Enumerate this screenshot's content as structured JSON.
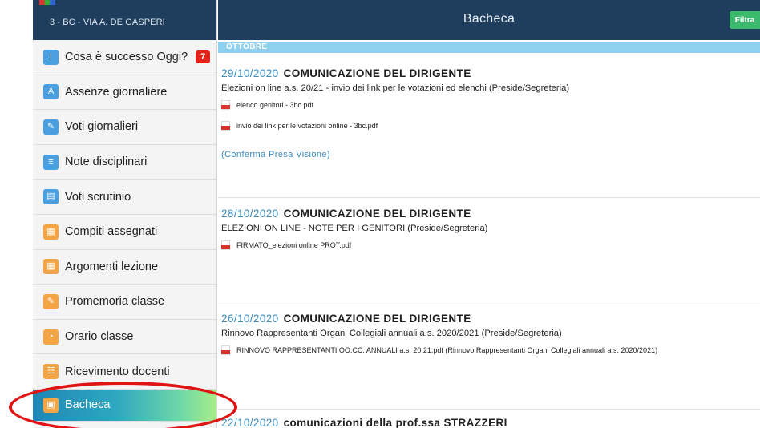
{
  "sidebar": {
    "school_name": "3 - BC - VIA A. DE GASPERI",
    "items": [
      {
        "label": "Cosa è successo Oggi?",
        "icon": "alert-icon",
        "badge": "7"
      },
      {
        "label": "Assenze giornaliere",
        "icon": "attendance-icon"
      },
      {
        "label": "Voti giornalieri",
        "icon": "grades-icon"
      },
      {
        "label": "Note disciplinari",
        "icon": "notes-icon"
      },
      {
        "label": "Voti scrutinio",
        "icon": "report-card-icon"
      },
      {
        "label": "Compiti assegnati",
        "icon": "homework-icon"
      },
      {
        "label": "Argomenti lezione",
        "icon": "lesson-topics-icon"
      },
      {
        "label": "Promemoria classe",
        "icon": "reminder-icon"
      },
      {
        "label": "Orario classe",
        "icon": "clock-icon"
      },
      {
        "label": "Ricevimento docenti",
        "icon": "meeting-icon"
      },
      {
        "label": "Bacheca",
        "icon": "board-icon"
      }
    ]
  },
  "header": {
    "title": "Bacheca",
    "filter_label": "Filtra"
  },
  "month_label": "OTTOBRE",
  "posts": [
    {
      "date": "29/10/2020",
      "title": "COMUNICAZIONE DEL DIRIGENTE",
      "subtitle": "Elezioni on line a.s. 20/21 - invio dei link per le votazioni ed elenchi (Preside/Segreteria)",
      "attachments": [
        "elenco genitori - 3bc.pdf",
        "invio dei link per le votazioni online - 3bc.pdf"
      ],
      "confirm": "(Conferma Presa Visione)"
    },
    {
      "date": "28/10/2020",
      "title": "COMUNICAZIONE DEL DIRIGENTE",
      "subtitle": "ELEZIONI ON LINE - NOTE PER I GENITORI (Preside/Segreteria)",
      "attachments": [
        "FIRMATO_elezioni online PROT.pdf"
      ]
    },
    {
      "date": "26/10/2020",
      "title": "COMUNICAZIONE DEL DIRIGENTE",
      "subtitle": "Rinnovo Rappresentanti Organi Collegiali annuali a.s. 2020/2021 (Preside/Segreteria)",
      "attachments": [
        "RINNOVO RAPPRESENTANTI OO.CC. ANNUALI a.s. 20.21.pdf (Rinnovo Rappresentanti Organi Collegiali annuali a.s. 2020/2021)"
      ]
    },
    {
      "date": "22/10/2020",
      "title": "comunicazioni della prof.ssa STRAZZERI"
    }
  ],
  "colors": {
    "header_bg": "#1f3d5c",
    "date_blue": "#3a8bc2",
    "badge_red": "#e2231a",
    "filter_green": "#3bb96d",
    "highlight_red": "#e01414"
  }
}
